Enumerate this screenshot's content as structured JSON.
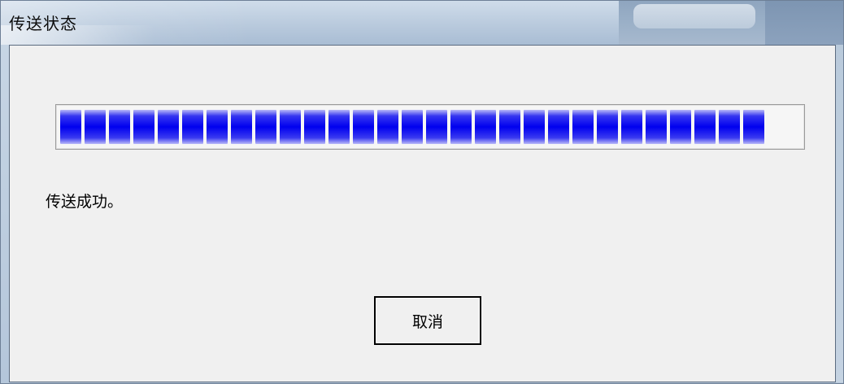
{
  "window": {
    "title": "传送状态"
  },
  "progress": {
    "fraction": 0.94,
    "block_count": 29,
    "color": "#0000ef"
  },
  "status": {
    "text": "传送成功。"
  },
  "buttons": {
    "cancel_label": "取消"
  }
}
